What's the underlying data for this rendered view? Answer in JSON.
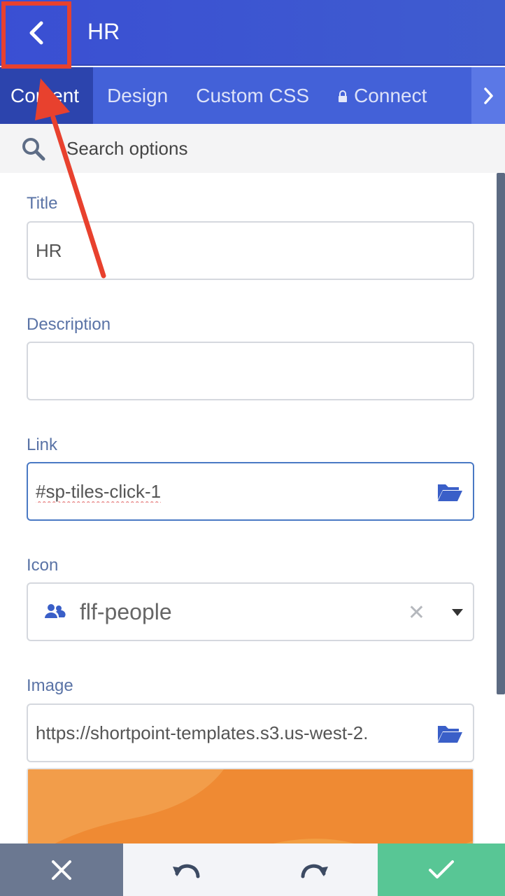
{
  "header": {
    "title": "HR",
    "back_icon": "chevron-left-icon"
  },
  "tabs": [
    {
      "label": "Content",
      "active": true
    },
    {
      "label": "Design",
      "active": false
    },
    {
      "label": "Custom CSS",
      "active": false
    },
    {
      "label": "Connect",
      "active": false,
      "icon": "lock-icon"
    }
  ],
  "tabs_more_icon": "chevron-right-icon",
  "search": {
    "placeholder": "Search options",
    "icon": "search-icon"
  },
  "fields": {
    "title": {
      "label": "Title",
      "value": "HR"
    },
    "description": {
      "label": "Description",
      "value": ""
    },
    "link": {
      "label": "Link",
      "value": "#sp-tiles-click-1",
      "icon": "folder-open-icon"
    },
    "icon": {
      "label": "Icon",
      "value": "flf-people",
      "icon": "people-icon"
    },
    "image": {
      "label": "Image",
      "value": "https://shortpoint-templates.s3.us-west-2.",
      "icon": "folder-open-icon"
    }
  },
  "bottom_bar": {
    "cancel_icon": "close-icon",
    "undo_icon": "undo-icon",
    "redo_icon": "redo-icon",
    "confirm_icon": "checkmark-icon"
  },
  "colors": {
    "header": "#3a4fd3",
    "tabs": "#4361d8",
    "active_tab": "#2c44ad",
    "label": "#5a73a6",
    "annotation": "#e8412e",
    "confirm": "#58c695",
    "cancel": "#6b7891"
  }
}
